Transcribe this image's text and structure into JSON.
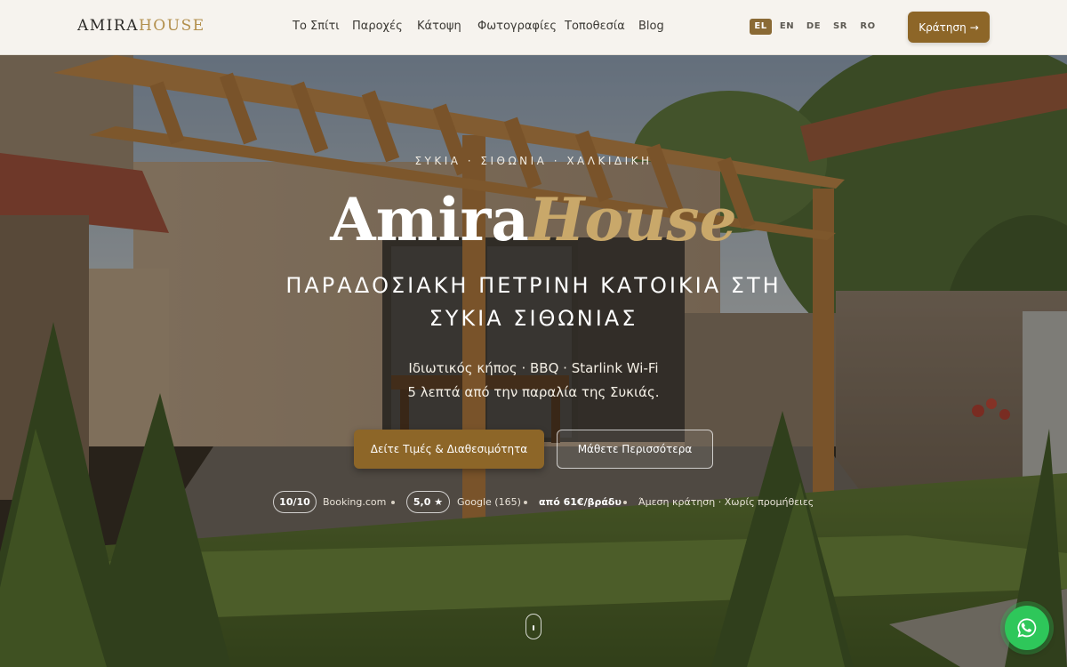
{
  "header": {
    "logo_part1": "AMIRA",
    "logo_part2": "HOUSE",
    "nav": [
      "Το Σπίτι",
      "Παροχές",
      "Κάτοψη",
      "Φωτογραφίες",
      "Τοποθεσία",
      "Blog"
    ],
    "languages": [
      "EL",
      "EN",
      "DE",
      "SR",
      "RO"
    ],
    "active_language": "EL",
    "book_label": "Κράτηση",
    "book_arrow": "→"
  },
  "hero": {
    "kicker": "ΣΥΚΙΑ · ΣΙΘΩΝΙΑ · ΧΑΛΚΙΔΙΚΗ",
    "title_part1": "Amira",
    "title_part2": "House",
    "subtitle_line1": "ΠΑΡΑΔΟΣΙΑΚΗ ΠΕΤΡΙΝΗ ΚΑΤΟΙΚΙΑ ΣΤΗ",
    "subtitle_line2": "ΣΥΚΙΑ ΣΙΘΩΝΙΑΣ",
    "tagline_line1": "Ιδιωτικός κήπος · BBQ · Starlink Wi-Fi",
    "tagline_line2": "5 λεπτά από την παραλία της Συκιάς.",
    "primary_cta": "Δείτε Τιμές & Διαθεσιμότητα",
    "secondary_cta": "Μάθετε Περισσότερα"
  },
  "proof": {
    "booking_score": "10/10",
    "booking_source": "Booking.com",
    "google_score": "5,0 ★",
    "google_source": "Google (165)",
    "price": "από 61€/βράδυ",
    "note": "Άμεση κράτηση · Χωρίς προμήθειες"
  },
  "colors": {
    "accent": "#8d6628",
    "gold_text": "#c9a86a",
    "header_bg": "#f6f3ee",
    "whatsapp": "#2ec75a"
  },
  "icons": {
    "scroll": "mouse-scroll-icon",
    "whatsapp": "whatsapp-icon"
  }
}
